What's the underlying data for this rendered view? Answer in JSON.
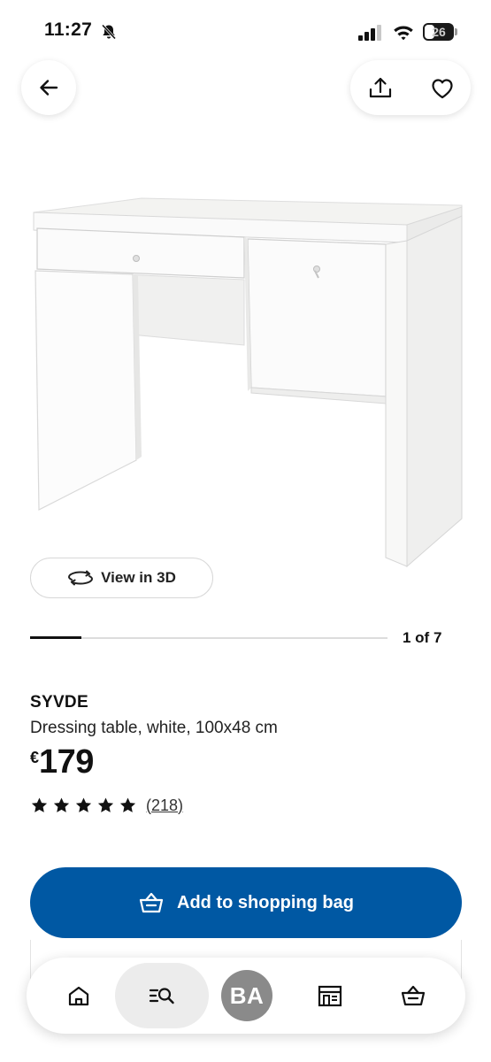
{
  "status_bar": {
    "time": "11:27",
    "battery": "26"
  },
  "carousel": {
    "view_3d_label": "View in 3D",
    "counter": "1 of 7",
    "progress": 0.143
  },
  "product": {
    "name": "SYVDE",
    "description": "Dressing table, white, 100x48 cm",
    "price_currency": "€",
    "price_amount": "179",
    "rating_stars": 5,
    "review_count": "(218)"
  },
  "actions": {
    "add_to_bag_label": "Add to shopping bag"
  },
  "tab_bar": {
    "avatar_initials": "BA",
    "active_tab": "search"
  },
  "icons": {
    "back": "arrow-left-icon",
    "share": "share-icon",
    "favorite": "heart-icon",
    "home": "home-icon",
    "search": "search-list-icon",
    "stores": "store-icon",
    "bag": "shopping-bag-icon"
  },
  "colors": {
    "primary_button": "#0058a3",
    "avatar_bg": "#8a8a8a"
  }
}
